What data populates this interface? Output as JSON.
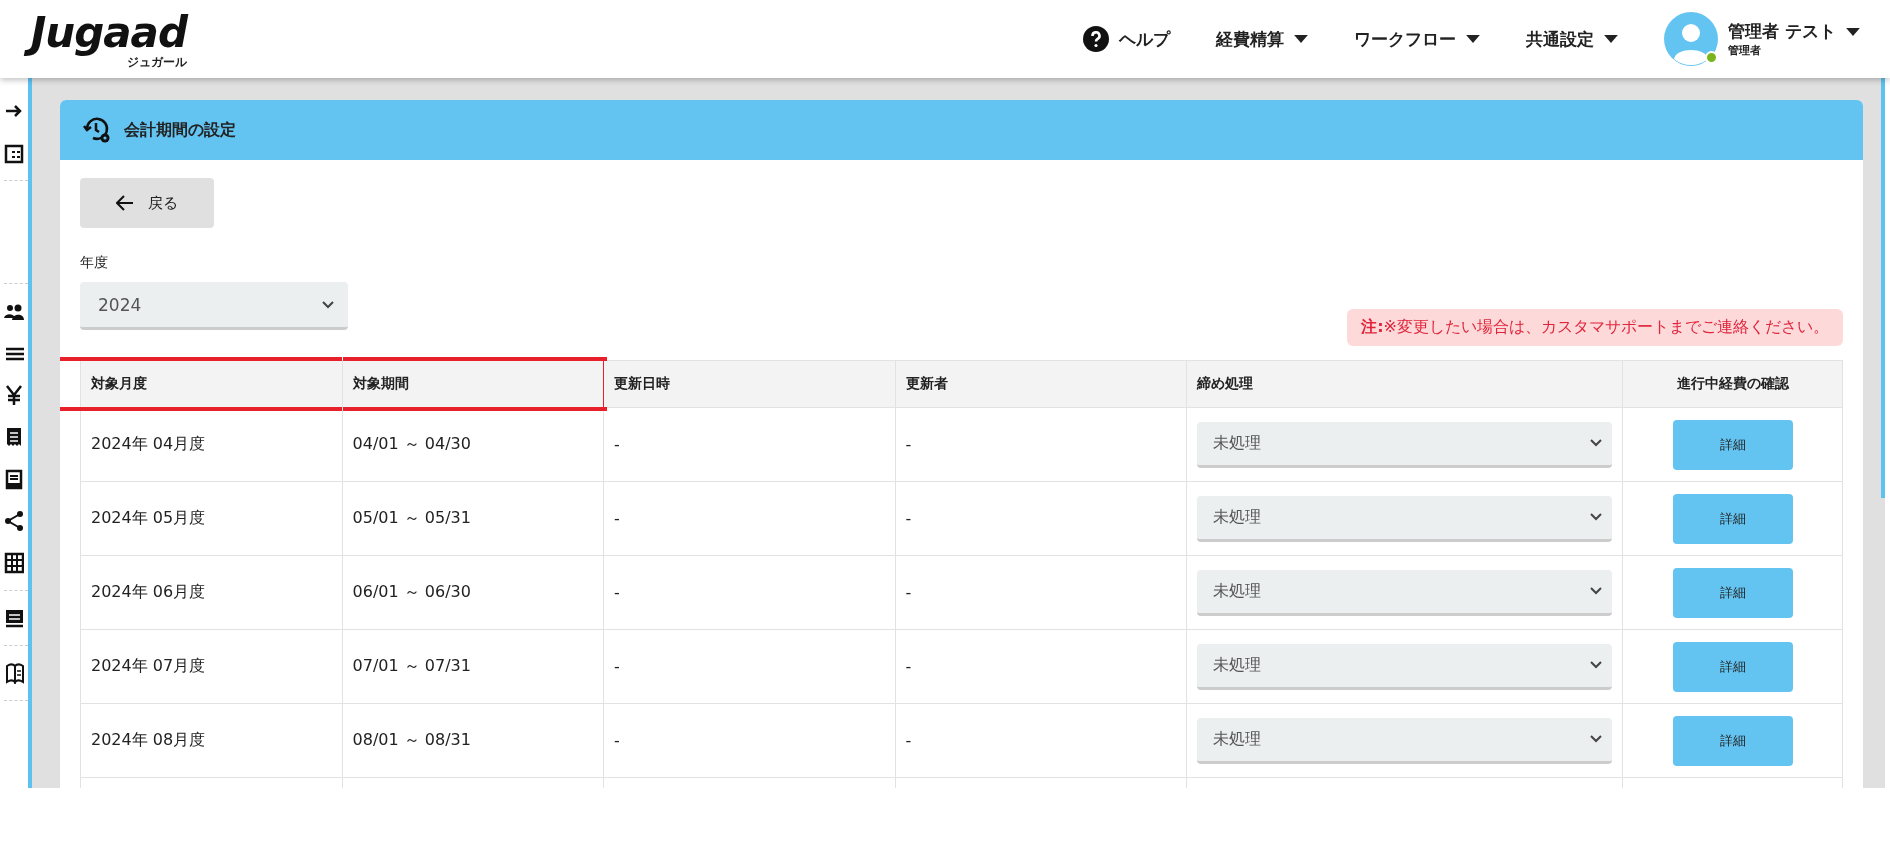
{
  "header": {
    "logo": "Jugaad",
    "logo_sub": "ジュガール",
    "nav": [
      {
        "label": "ヘルプ",
        "kind": "help"
      },
      {
        "label": "経費精算",
        "kind": "dropdown"
      },
      {
        "label": "ワークフロー",
        "kind": "dropdown"
      },
      {
        "label": "共通設定",
        "kind": "dropdown"
      }
    ],
    "user": {
      "name": "管理者 テスト",
      "role": "管理者",
      "online": true
    }
  },
  "panel": {
    "title": "会計期間の設定",
    "back_button": "戻る",
    "year": {
      "label": "年度",
      "value": "2024"
    },
    "notice": "**注:**※変更したい場合は、カスタマサポートまでご連絡ください。"
  },
  "table": {
    "columns": [
      {
        "label": "対象月度",
        "highlighted": true
      },
      {
        "label": "対象期間",
        "highlighted": true
      },
      {
        "label": "更新日時",
        "highlighted": false
      },
      {
        "label": "更新者",
        "highlighted": false
      },
      {
        "label": "締め処理",
        "highlighted": false
      },
      {
        "label": "進行中経費の確認",
        "highlighted": false
      }
    ],
    "rows": [
      {
        "month": "2024年 04月度",
        "period": "04/01 ～ 04/30",
        "updated_at": "-",
        "updated_by": "-",
        "status": "未処理",
        "action": "詳細"
      },
      {
        "month": "2024年 05月度",
        "period": "05/01 ～ 05/31",
        "updated_at": "-",
        "updated_by": "-",
        "status": "未処理",
        "action": "詳細"
      },
      {
        "month": "2024年 06月度",
        "period": "06/01 ～ 06/30",
        "updated_at": "-",
        "updated_by": "-",
        "status": "未処理",
        "action": "詳細"
      },
      {
        "month": "2024年 07月度",
        "period": "07/01 ～ 07/31",
        "updated_at": "-",
        "updated_by": "-",
        "status": "未処理",
        "action": "詳細"
      },
      {
        "month": "2024年 08月度",
        "period": "08/01 ～ 08/31",
        "updated_at": "-",
        "updated_by": "-",
        "status": "未処理",
        "action": "詳細"
      }
    ]
  }
}
